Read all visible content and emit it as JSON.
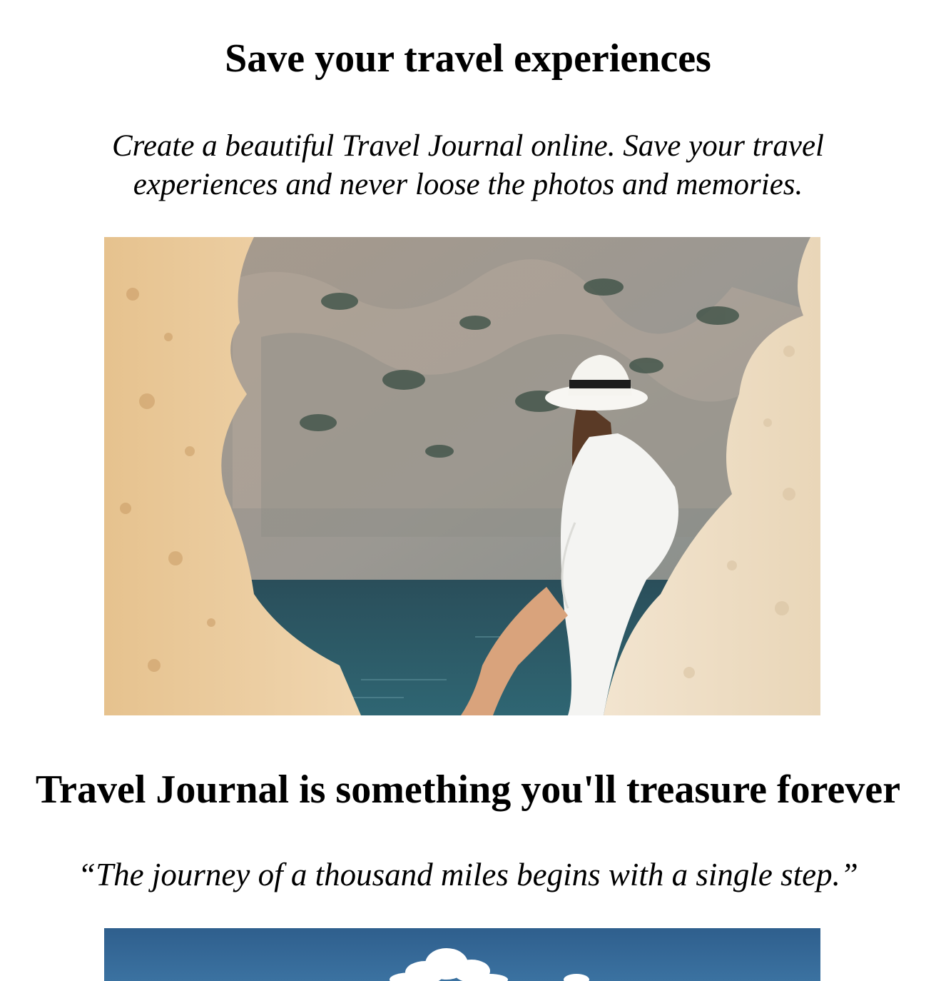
{
  "hero": {
    "title": "Save your travel experiences",
    "lead": "Create a beautiful Travel Journal online. Save your travel experiences and never loose the photos and memories."
  },
  "section": {
    "title": "Travel Journal is something you'll treasure forever",
    "quote": "“The journey of a thousand miles begins with a single step.”"
  },
  "colors": {
    "sandstone": "#e8c9a0",
    "cliff": "#9a9690",
    "sea": "#2d5a66",
    "sky": "#356894"
  }
}
